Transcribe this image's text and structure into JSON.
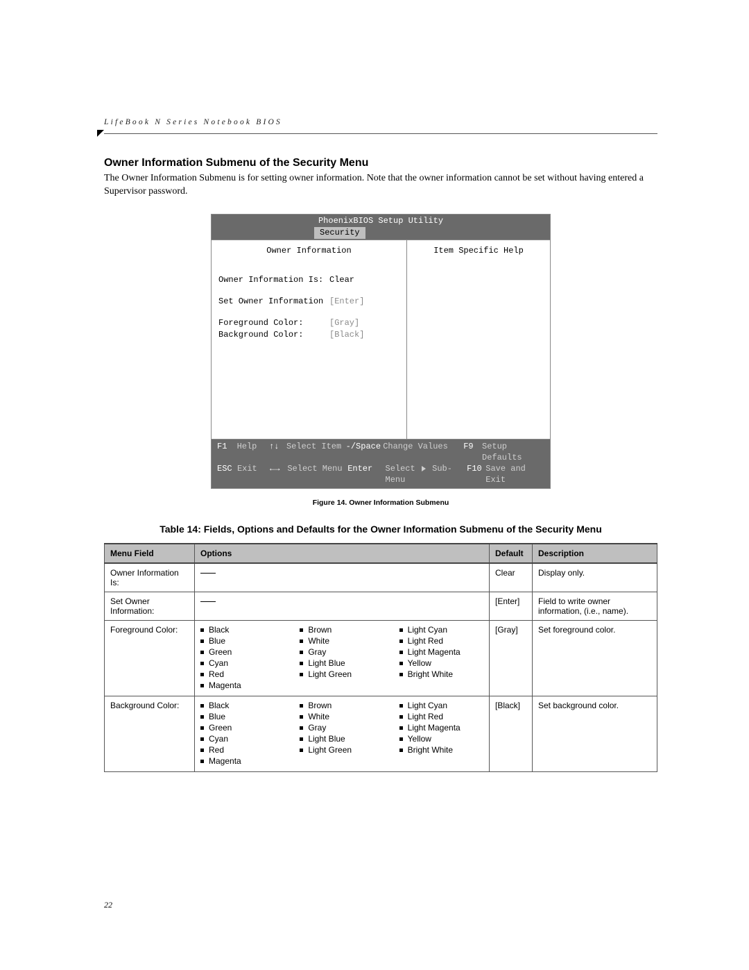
{
  "header": {
    "running": "LifeBook N Series Notebook BIOS"
  },
  "section": {
    "title": "Owner Information Submenu of the Security Menu",
    "body": "The Owner Information Submenu is for setting owner information. Note that the owner information cannot be set without having entered a Supervisor password."
  },
  "bios": {
    "title": "PhoenixBIOS Setup Utility",
    "tab": "Security",
    "left_header": "Owner Information",
    "right_header": "Item Specific Help",
    "rows": [
      {
        "label": "Owner Information Is:",
        "value": "Clear",
        "dim": false
      },
      {
        "label": "",
        "value": "",
        "gap": true
      },
      {
        "label": "Set Owner Information",
        "value": "[Enter]",
        "dim": true
      },
      {
        "label": "",
        "value": "",
        "gap": true
      },
      {
        "label": "Foreground Color:",
        "value": "[Gray]",
        "dim": true
      },
      {
        "label": "Background Color:",
        "value": "[Black]",
        "dim": true
      }
    ],
    "footer": {
      "r1": {
        "k1": "F1",
        "l1": "Help",
        "arr": "↑↓",
        "sel": "Select Item",
        "mk": "-/Space",
        "ml": "Change Values",
        "fk": "F9",
        "fl": "Setup Defaults"
      },
      "r2": {
        "k1": "ESC",
        "l1": "Exit",
        "arr": "←→",
        "sel": "Select Menu",
        "mk": "Enter",
        "ml_pre": "Select ",
        "ml_post": " Sub-Menu",
        "fk": "F10",
        "fl": "Save and Exit"
      }
    }
  },
  "figure_caption": "Figure 14.  Owner Information Submenu",
  "table_caption": "Table 14: Fields, Options and Defaults for the Owner Information Submenu of the Security Menu",
  "table": {
    "headers": [
      "Menu Field",
      "Options",
      "Default",
      "Description"
    ],
    "rows": [
      {
        "field": "Owner Information Is:",
        "options_dash": true,
        "options": [],
        "default": "Clear",
        "description": "Display only."
      },
      {
        "field": "Set Owner Information:",
        "options_dash": true,
        "options": [],
        "default": "[Enter]",
        "description": "Field to write owner information, (i.e., name)."
      },
      {
        "field": "Foreground Color:",
        "options_dash": false,
        "options": [
          [
            "Black",
            "Blue",
            "Green",
            "Cyan",
            "Red",
            "Magenta"
          ],
          [
            "Brown",
            "White",
            "Gray",
            "Light Blue",
            "Light Green"
          ],
          [
            "Light Cyan",
            "Light Red",
            "Light Magenta",
            "Yellow",
            "Bright White"
          ]
        ],
        "default": "[Gray]",
        "description": "Set foreground color."
      },
      {
        "field": "Background Color:",
        "options_dash": false,
        "options": [
          [
            "Black",
            "Blue",
            "Green",
            "Cyan",
            "Red",
            "Magenta"
          ],
          [
            "Brown",
            "White",
            "Gray",
            "Light Blue",
            "Light Green"
          ],
          [
            "Light Cyan",
            "Light Red",
            "Light Magenta",
            "Yellow",
            "Bright White"
          ]
        ],
        "default": "[Black]",
        "description": "Set background color."
      }
    ]
  },
  "page_number": "22"
}
